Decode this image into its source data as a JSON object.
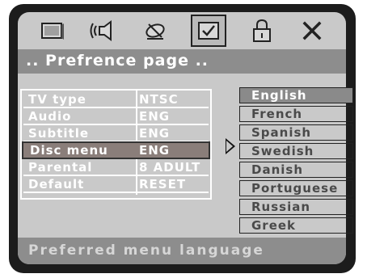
{
  "icons": [
    "tv-icon",
    "speaker-icon",
    "satellite-icon",
    "checkbox-icon",
    "lock-icon",
    "close-icon"
  ],
  "header": {
    "title": ".. Prefrence page .."
  },
  "menu": {
    "rows": [
      {
        "key": "TV type",
        "value": "NTSC"
      },
      {
        "key": "Audio",
        "value": "ENG"
      },
      {
        "key": "Subtitle",
        "value": "ENG"
      },
      {
        "key": "Disc menu",
        "value": "ENG"
      },
      {
        "key": "Parental",
        "value": "8 ADULT"
      },
      {
        "key": "Default",
        "value": "RESET"
      }
    ],
    "selected": "Disc menu"
  },
  "languages": {
    "options": [
      "English",
      "French",
      "Spanish",
      "Swedish",
      "Danish",
      "Portuguese",
      "Russian",
      "Greek"
    ],
    "selected": "English"
  },
  "status": {
    "text": "Preferred menu language"
  },
  "colors": {
    "bezel": "#1c1c1c",
    "panel": "#c9c9c9",
    "bar": "#8d8d8d",
    "highlight": "#8a7e7a"
  }
}
